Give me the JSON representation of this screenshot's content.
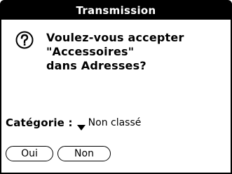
{
  "dialog": {
    "title": "Transmission",
    "icon": "question-icon",
    "message_lines": [
      "Voulez-vous accepter",
      "\"Accessoires\"",
      "dans Adresses?"
    ]
  },
  "category": {
    "label": "Catégorie :",
    "value": "Non classé",
    "arrow_icon": "dropdown-arrow-icon"
  },
  "buttons": {
    "yes_label": "Oui",
    "no_label": "Non"
  }
}
